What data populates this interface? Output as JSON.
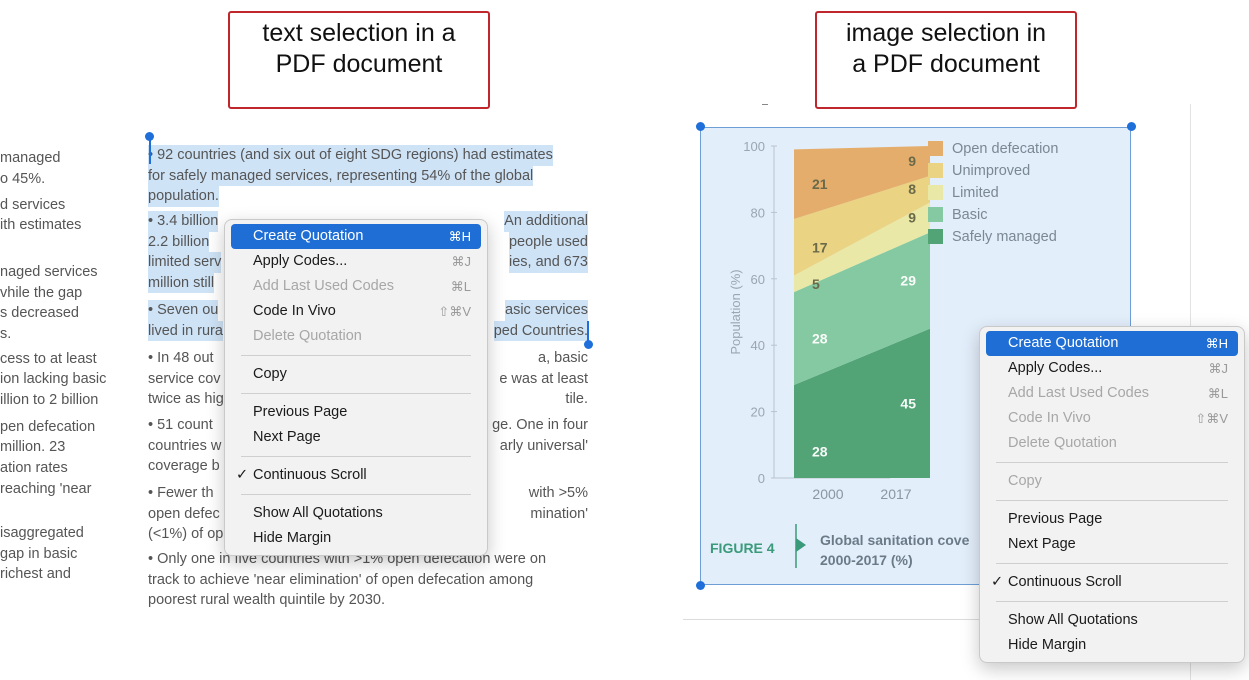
{
  "callouts": {
    "left": [
      "text selection in a",
      "PDF document"
    ],
    "right": [
      "image selection in",
      "a PDF document"
    ]
  },
  "left_column_fragments": [
    "managed",
    "o 45%.",
    "d services",
    "ith estimates",
    "naged services",
    "vhile the gap",
    "s decreased",
    "s.",
    "cess to at least",
    "ion lacking basic",
    "illion to 2 billion",
    "pen defecation",
    "million. 23",
    "ation rates",
    "reaching 'near",
    "isaggregated",
    "gap in basic",
    "richest and"
  ],
  "document_paragraphs": [
    {
      "lines": [
        "• 92 countries (and six out of eight SDG regions) had estimates",
        "for safely managed services, representing 54% of the global",
        "population."
      ],
      "highlight": [
        true,
        true,
        true
      ]
    },
    {
      "lines": [
        "• 3.4 billion ",
        "2.2 billion ",
        "limited serv",
        "million still "
      ],
      "tails": [
        "An additional",
        "people used",
        "ies, and 673",
        ""
      ],
      "highlight": [
        true,
        true,
        true,
        true
      ]
    },
    {
      "lines": [
        "• Seven ou",
        "lived in rura"
      ],
      "tails": [
        "asic services",
        "ped Countries."
      ],
      "highlight": [
        true,
        true
      ]
    },
    {
      "lines": [
        "• In 48 out",
        "service cov",
        "twice as hig"
      ],
      "tails": [
        "a, basic",
        "e was at least",
        "tile."
      ],
      "highlight": [
        false,
        false,
        false
      ]
    },
    {
      "lines": [
        "• 51 count",
        "countries w",
        "coverage b"
      ],
      "tails": [
        "ge. One in four",
        "arly universal'",
        ""
      ],
      "highlight": [
        false,
        false,
        false
      ]
    },
    {
      "lines": [
        "• Fewer th",
        "open defec",
        "(<1%) of op"
      ],
      "tails": [
        "with >5%",
        "mination'",
        ""
      ],
      "highlight": [
        false,
        false,
        false
      ]
    },
    {
      "lines": [
        "• Only one in five countries with >1% open defecation were on",
        "track to achieve 'near elimination' of open defecation among",
        "poorest rural wealth quintile by 2030."
      ],
      "highlight": [
        false,
        false,
        false
      ]
    }
  ],
  "context_menu_left": {
    "items": [
      {
        "label": "Create Quotation",
        "shortcut": "⌘H",
        "state": "selected"
      },
      {
        "label": "Apply Codes...",
        "shortcut": "⌘J",
        "state": "enabled"
      },
      {
        "label": "Add Last Used Codes",
        "shortcut": "⌘L",
        "state": "disabled"
      },
      {
        "label": "Code In Vivo",
        "shortcut": "⇧⌘V",
        "state": "enabled"
      },
      {
        "label": "Delete Quotation",
        "shortcut": "",
        "state": "disabled"
      },
      {
        "label": "Copy",
        "shortcut": "",
        "state": "enabled"
      },
      {
        "label": "Previous Page",
        "shortcut": "",
        "state": "enabled"
      },
      {
        "label": "Next Page",
        "shortcut": "",
        "state": "enabled"
      },
      {
        "label": "Continuous Scroll",
        "shortcut": "",
        "state": "checked"
      },
      {
        "label": "Show All Quotations",
        "shortcut": "",
        "state": "enabled"
      },
      {
        "label": "Hide Margin",
        "shortcut": "",
        "state": "enabled"
      }
    ]
  },
  "context_menu_right": {
    "items": [
      {
        "label": "Create Quotation",
        "shortcut": "⌘H",
        "state": "selected"
      },
      {
        "label": "Apply Codes...",
        "shortcut": "⌘J",
        "state": "enabled"
      },
      {
        "label": "Add Last Used Codes",
        "shortcut": "⌘L",
        "state": "disabled"
      },
      {
        "label": "Code In Vivo",
        "shortcut": "⇧⌘V",
        "state": "disabled"
      },
      {
        "label": "Delete Quotation",
        "shortcut": "",
        "state": "disabled"
      },
      {
        "label": "Copy",
        "shortcut": "",
        "state": "disabled"
      },
      {
        "label": "Previous Page",
        "shortcut": "",
        "state": "enabled"
      },
      {
        "label": "Next Page",
        "shortcut": "",
        "state": "enabled"
      },
      {
        "label": "Continuous Scroll",
        "shortcut": "",
        "state": "checked"
      },
      {
        "label": "Show All Quotations",
        "shortcut": "",
        "state": "enabled"
      },
      {
        "label": "Hide Margin",
        "shortcut": "",
        "state": "enabled"
      }
    ]
  },
  "figure": {
    "label": "FIGURE 4",
    "title_line1": "Global sanitation cove",
    "title_line2": "2000-2017 (%)"
  },
  "colors": {
    "selection": "#cfe3f7",
    "handle": "#1f6fdb",
    "menu_highlight": "#1f6ed6",
    "open_defecation": "#e5ad6b",
    "unimproved": "#ead383",
    "limited": "#eae8a6",
    "basic": "#84c9a1",
    "safely_managed": "#52a376"
  },
  "chart_data": {
    "type": "bar",
    "stacked": true,
    "categories": [
      "2000",
      "2017"
    ],
    "ylabel": "Population (%)",
    "ylim": [
      0,
      100
    ],
    "yticks": [
      0,
      20,
      40,
      60,
      80,
      100
    ],
    "series": [
      {
        "name": "Safely managed",
        "values": [
          28,
          45
        ],
        "color": "#52a376"
      },
      {
        "name": "Basic",
        "values": [
          28,
          29
        ],
        "color": "#84c9a1"
      },
      {
        "name": "Limited",
        "values": [
          5,
          9
        ],
        "color": "#eae8a6"
      },
      {
        "name": "Unimproved",
        "values": [
          17,
          8
        ],
        "color": "#ead383"
      },
      {
        "name": "Open defecation",
        "values": [
          21,
          9
        ],
        "color": "#e5ad6b"
      }
    ],
    "legend_order": [
      "Open defecation",
      "Unimproved",
      "Limited",
      "Basic",
      "Safely managed"
    ],
    "legend_position": "top-right"
  }
}
